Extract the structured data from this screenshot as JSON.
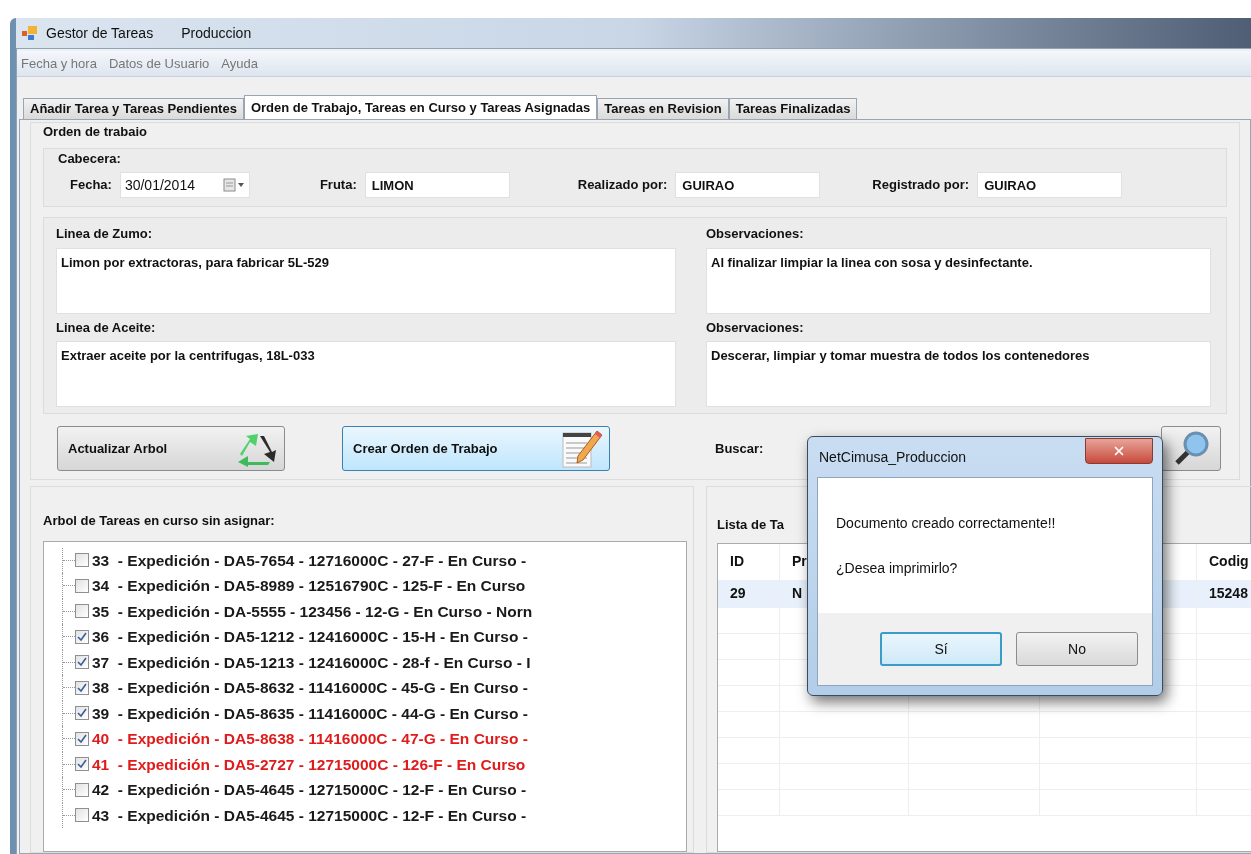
{
  "window": {
    "title": "Gestor de Tareas",
    "subtitle": "Produccion"
  },
  "menu": [
    "Fecha y hora",
    "Datos de Usuario",
    "Ayuda"
  ],
  "tabs": [
    {
      "label": "Añadir Tarea  y  Tareas Pendientes",
      "selected": false
    },
    {
      "label": "Orden de Trabajo, Tareas en Curso y Tareas Asignadas",
      "selected": true
    },
    {
      "label": "Tareas en Revision",
      "selected": false
    },
    {
      "label": "Tareas Finalizadas",
      "selected": false
    }
  ],
  "work_order": {
    "title": "Orden de trabaio",
    "header_title": "Cabecera:",
    "fields": [
      {
        "label": "Fecha:",
        "value": "30/01/2014",
        "kind": "date"
      },
      {
        "label": "Fruta:",
        "value": "LIMON",
        "kind": "text"
      },
      {
        "label": "Realizado por:",
        "value": "GUIRAO",
        "kind": "text"
      },
      {
        "label": "Registrado por:",
        "value": "GUIRAO",
        "kind": "text"
      }
    ],
    "sections": [
      {
        "label": "Linea de Zumo:",
        "value": "Limon por extractoras, para fabricar 5L-529"
      },
      {
        "label": "Observaciones:",
        "value": "Al finalizar limpiar la linea con sosa y desinfectante."
      },
      {
        "label": "Linea de Aceite:",
        "value": "Extraer aceite por la centrifugas, 18L-033"
      },
      {
        "label": "Observaciones:",
        "value": "Descerar, limpiar y tomar muestra de todos los contenedores"
      }
    ],
    "buttons": [
      {
        "label": "Actualizar  Arbol",
        "kind": "refresh"
      },
      {
        "label": "Crear Orden de Trabajo",
        "kind": "create"
      }
    ],
    "search_label": "Buscar:"
  },
  "tree": {
    "title": "Arbol de Tareas en curso sin asignar:",
    "items": [
      {
        "label": "33  - Expedición - DA5-7654 - 12716000C - 27-F - En Curso -",
        "checked": false,
        "color": "#1a1a1a"
      },
      {
        "label": "34  - Expedición - DA5-8989 - 12516790C - 125-F - En Curso",
        "checked": false,
        "color": "#1a1a1a"
      },
      {
        "label": "35  - Expedición - DA-5555 - 123456 - 12-G - En Curso - Norn",
        "checked": false,
        "color": "#1a1a1a"
      },
      {
        "label": "36  - Expedición - DA5-1212 - 12416000C - 15-H - En Curso -",
        "checked": true,
        "color": "#1a1a1a"
      },
      {
        "label": "37  - Expedición - DA5-1213 - 12416000C - 28-f - En Curso - I",
        "checked": true,
        "color": "#1a1a1a"
      },
      {
        "label": "38  - Expedición - DA5-8632 - 11416000C - 45-G - En Curso -",
        "checked": true,
        "color": "#1a1a1a"
      },
      {
        "label": "39  - Expedición - DA5-8635 - 11416000C - 44-G - En Curso -",
        "checked": true,
        "color": "#1a1a1a"
      },
      {
        "label": "40  - Expedición - DA5-8638 - 11416000C - 47-G - En Curso -",
        "checked": true,
        "color": "#e01b1b"
      },
      {
        "label": "41  - Expedición - DA5-2727 - 12715000C - 126-F - En Curso",
        "checked": true,
        "color": "#e01b1b"
      },
      {
        "label": "42  - Expedición - DA5-4645 - 12715000C - 12-F - En Curso -",
        "checked": false,
        "color": "#1a1a1a"
      },
      {
        "label": "43  - Expedición - DA5-4645 - 12715000C - 12-F - En Curso -",
        "checked": false,
        "color": "#1a1a1a"
      }
    ]
  },
  "task_list": {
    "title": "Lista de Ta",
    "columns": [
      "ID",
      "Pr",
      "Codig"
    ],
    "rows": [
      {
        "cells": [
          "29",
          "N",
          "15248"
        ]
      }
    ]
  },
  "dialog": {
    "title": "NetCimusa_Produccion",
    "message": "Documento creado correctamente!!",
    "question": "¿Desea imprimirlo?",
    "buttons": [
      {
        "label": "Sí",
        "selected": true
      },
      {
        "label": "No",
        "selected": false
      }
    ]
  }
}
